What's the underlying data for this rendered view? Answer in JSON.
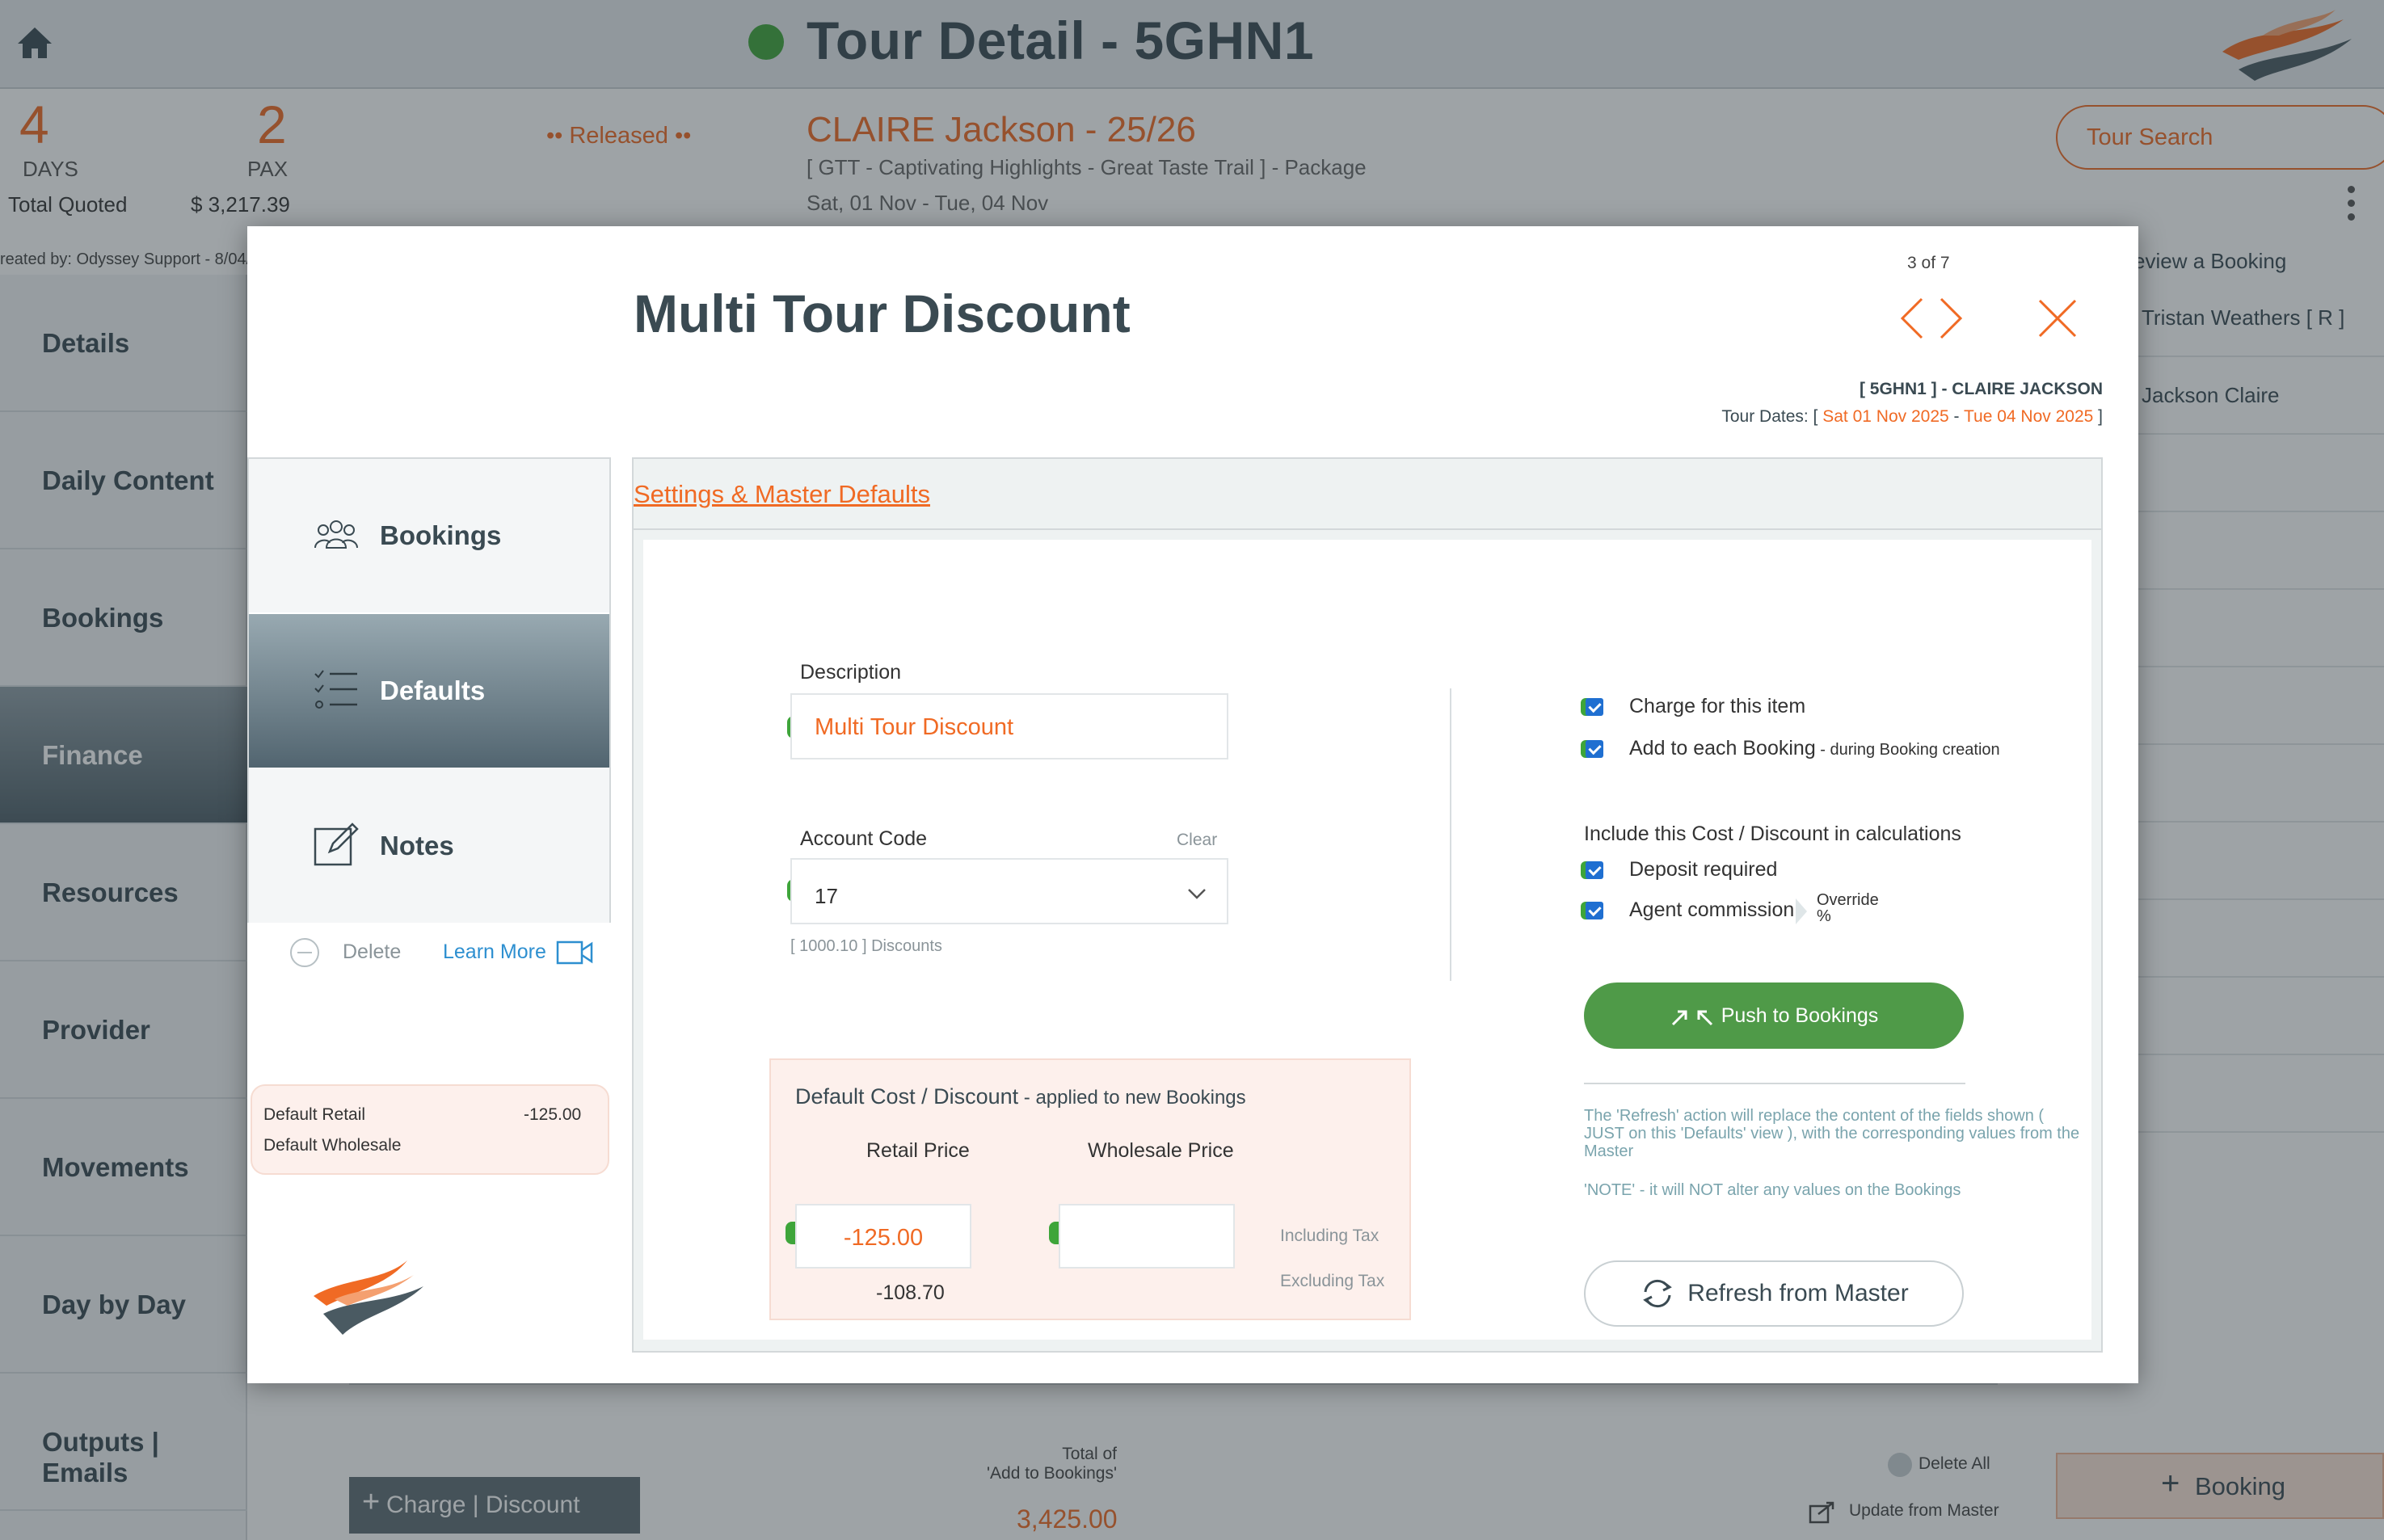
{
  "header": {
    "title": "Tour Detail - 5GHN1",
    "status_color": "#3ea53a"
  },
  "summary": {
    "days_value": "4",
    "days_label": "DAYS",
    "pax_value": "2",
    "pax_label": "PAX",
    "total_quoted_label": "Total Quoted",
    "total_quoted_value": "$ 3,217.39",
    "status": "•• Released ••",
    "client_name": "CLAIRE Jackson - 25/26",
    "package": "[ GTT - Captivating Highlights - Great Taste Trail ] - Package",
    "dates": "Sat, 01 Nov  - Tue, 04 Nov",
    "tour_search_label": "Tour Search",
    "created_by": "reated by: Odyssey Support - 8/04/"
  },
  "left_nav": {
    "items": [
      {
        "label": "Details"
      },
      {
        "label": "Daily Content"
      },
      {
        "label": "Bookings"
      },
      {
        "label": "Finance"
      },
      {
        "label": "Resources"
      },
      {
        "label": "Provider"
      },
      {
        "label": "Movements"
      },
      {
        "label": "Day by Day"
      },
      {
        "label": "Outputs | Emails"
      }
    ]
  },
  "right_panel": {
    "heading": "eview a Booking",
    "rows": [
      "Tristan Weathers  [ R ]",
      "Jackson Claire"
    ]
  },
  "footer": {
    "add_charge_label": "Charge | Discount",
    "total_label_line1": "Total of",
    "total_label_line2": "'Add to Bookings'",
    "total_value": "3,425.00",
    "delete_all_label": "Delete All",
    "update_master_label": "Update from Master",
    "add_booking_label": "Booking"
  },
  "modal": {
    "title": "Multi Tour Discount",
    "page_indicator": "3 of 7",
    "ref": "[ 5GHN1 ] - CLAIRE JACKSON",
    "dates_prefix": "Tour Dates: [ ",
    "date_start": "Sat 01 Nov 2025",
    "date_sep": " - ",
    "date_end": "Tue 04 Nov 2025",
    "dates_suffix": " ]",
    "tabs": [
      {
        "label": "Bookings",
        "icon": "group-icon"
      },
      {
        "label": "Defaults",
        "icon": "checklist-icon"
      },
      {
        "label": "Notes",
        "icon": "edit-note-icon"
      }
    ],
    "delete_label": "Delete",
    "learn_more_label": "Learn More",
    "default_retail_label": "Default Retail",
    "default_retail_value": "-125.00",
    "default_wholesale_label": "Default Wholesale",
    "settings": {
      "heading": "Settings & Master Defaults",
      "description_label": "Description",
      "description_value": "Multi Tour Discount",
      "account_code_label": "Account Code",
      "account_code_value": "17",
      "account_clear_label": "Clear",
      "account_hint": "[ 1000.10 ]  Discounts",
      "cost_heading": "Default Cost / Discount",
      "cost_subheading": " - applied to new Bookings",
      "retail_price_label": "Retail Price",
      "wholesale_price_label": "Wholesale Price",
      "retail_value": "-125.00",
      "retail_excl_value": "-108.70",
      "wholesale_value": "",
      "including_tax_label": "Including Tax",
      "excluding_tax_label": "Excluding Tax",
      "charge_item_label": "Charge for this item",
      "add_each_label": "Add to each Booking",
      "add_each_sub": " - during Booking creation",
      "include_label": "Include this Cost / Discount in calculations",
      "deposit_label": "Deposit required",
      "agent_commission_label": "Agent commission",
      "override_label_1": "Override",
      "override_label_2": "%",
      "push_label": "Push to Bookings",
      "refresh_note": "The 'Refresh' action will replace the content of the fields shown  ( JUST on this 'Defaults' view ), with the corresponding values from the Master",
      "refresh_note2": "'NOTE' - it will NOT alter any values on the Bookings",
      "refresh_label": "Refresh from Master"
    }
  },
  "colors": {
    "accent": "#f06a24",
    "success": "#3ea53a",
    "checkbox": "#1f6fd1",
    "button_green": "#4f9a48"
  }
}
